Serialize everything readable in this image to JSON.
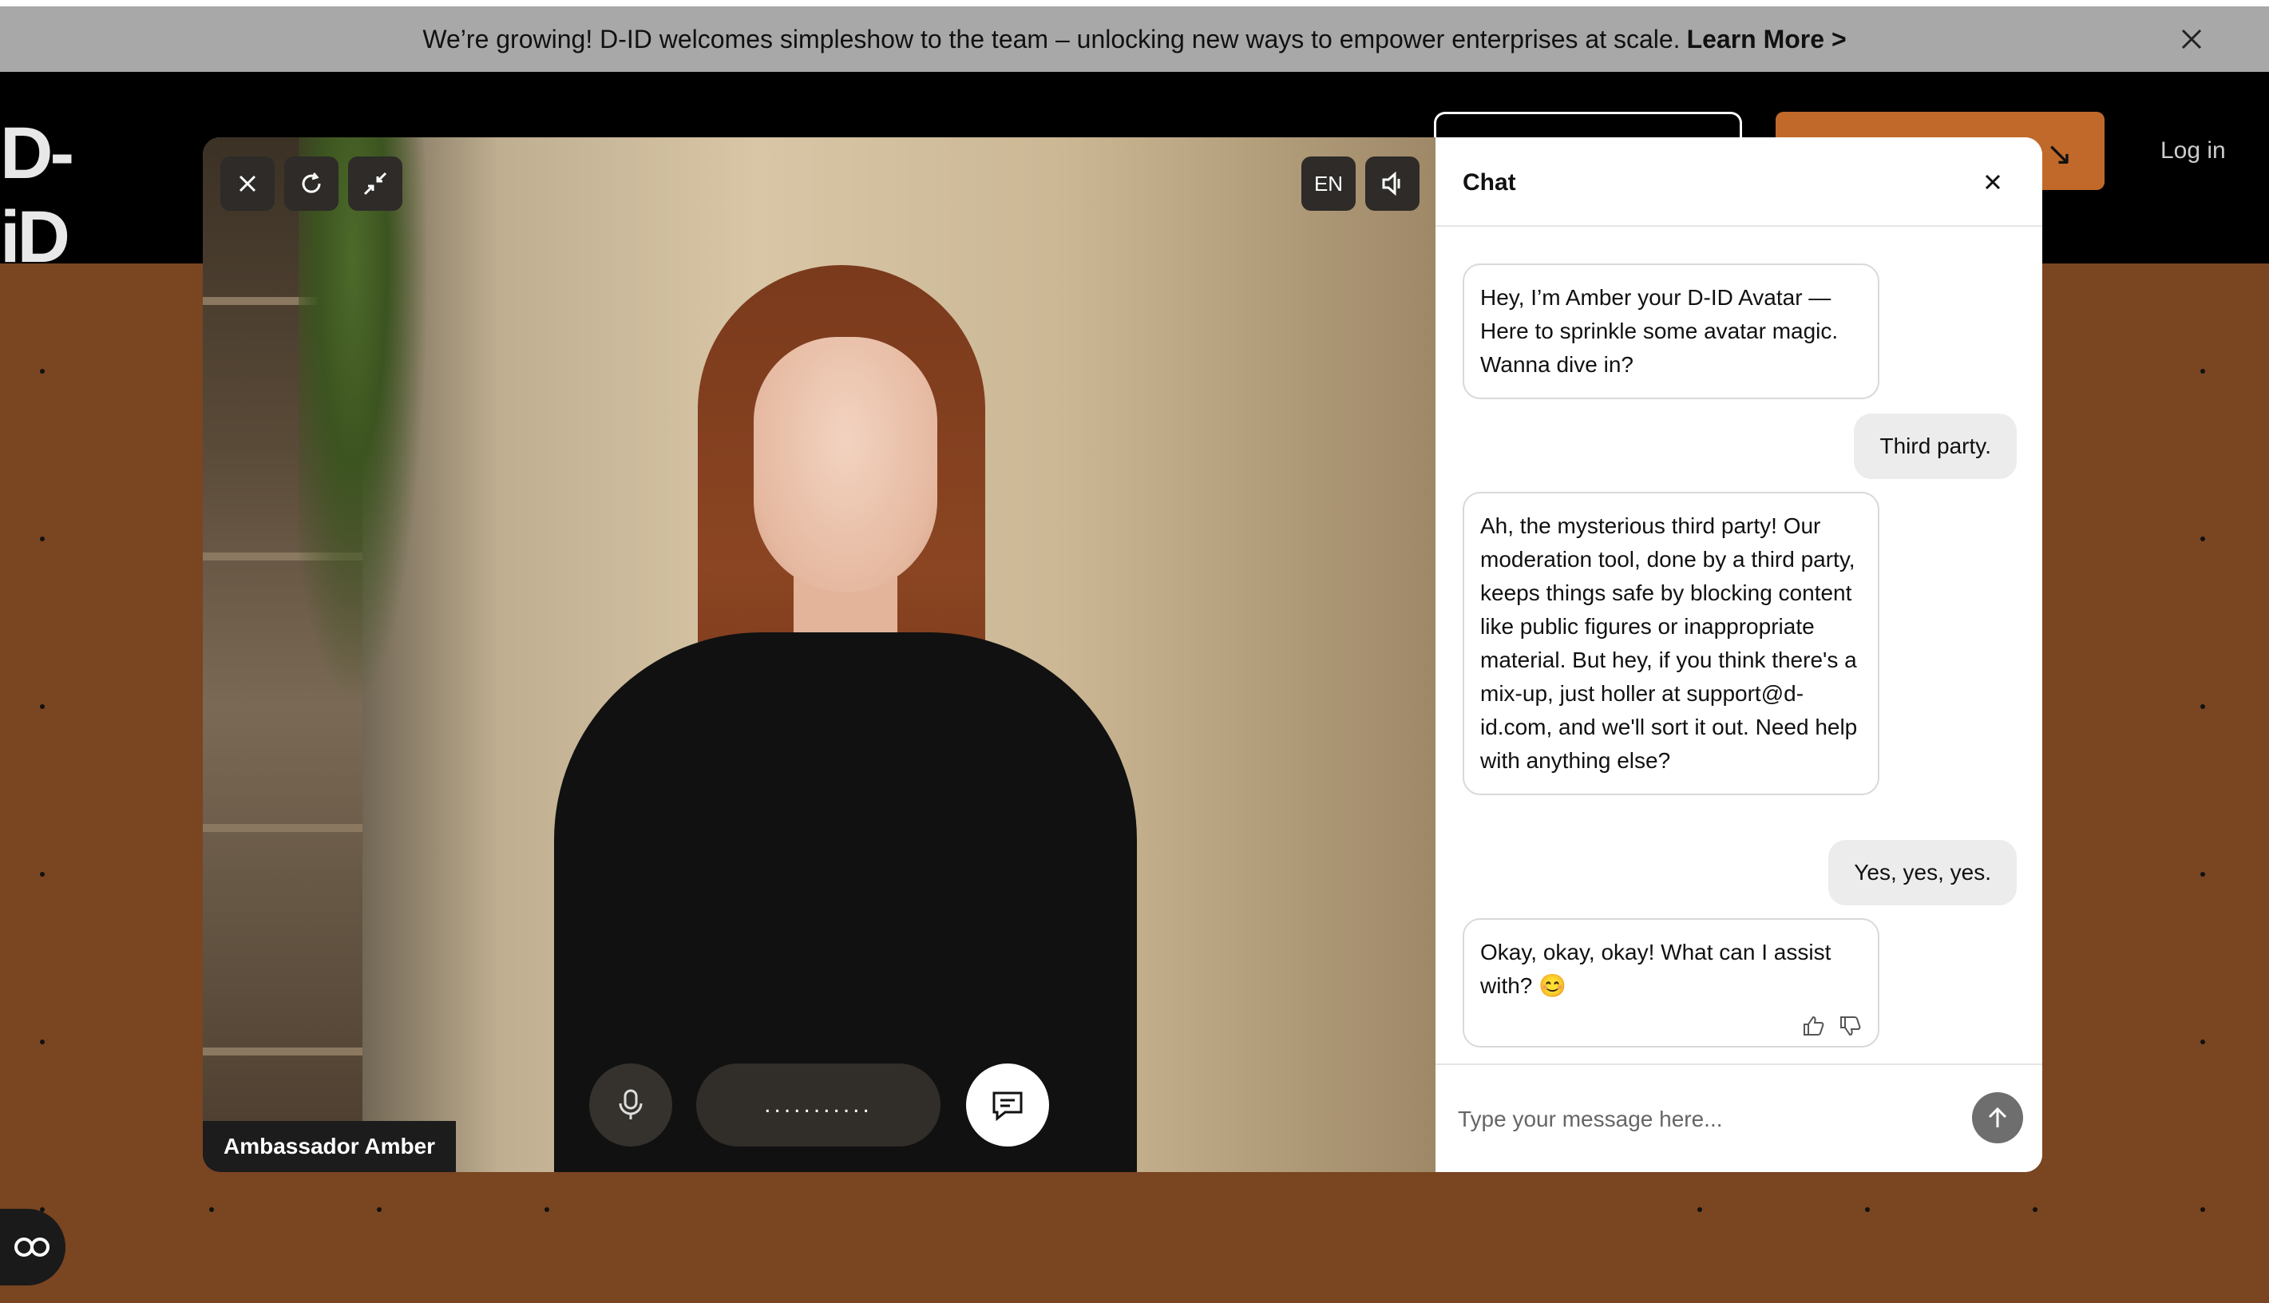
{
  "banner": {
    "text": "We’re growing! D-ID welcomes simpleshow to the team –  unlocking new ways to empower enterprises at scale.",
    "link": "Learn More >"
  },
  "nav": {
    "logo": "D-iD",
    "login": "Log in"
  },
  "video": {
    "language": "EN",
    "avatar_name": "Ambassador Amber",
    "status_dots": "..........."
  },
  "chat": {
    "title": "Chat",
    "messages": [
      {
        "role": "bot",
        "text": "Hey, I’m Amber your D-ID Avatar — Here to sprinkle some avatar magic. Wanna dive in?"
      },
      {
        "role": "user",
        "text": "Third party."
      },
      {
        "role": "bot",
        "text": "Ah, the mysterious third party! Our moderation tool, done by a third party, keeps things safe by blocking content like public figures or inappropriate material. But hey, if you think there's a mix-up, just holler at support@d-id.com, and we'll sort it out. Need help with anything else?"
      },
      {
        "role": "user",
        "text": "Yes, yes, yes."
      },
      {
        "role": "bot",
        "text": "Okay, okay, okay! What can I assist with? 😊"
      }
    ],
    "input_placeholder": "Type your message here..."
  },
  "colors": {
    "page_bg": "#7a4521",
    "accent_orange": "#c0692a",
    "banner_bg": "#a8a8a8"
  }
}
